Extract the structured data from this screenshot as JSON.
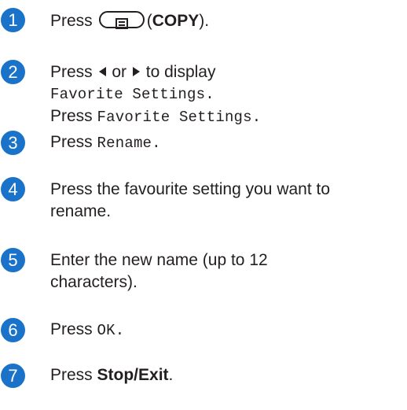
{
  "colors": {
    "badge": "#1a73c9",
    "text": "#231f20"
  },
  "steps": [
    {
      "num": "1",
      "pre": "Press",
      "post_open": "(",
      "bold": "COPY",
      "post_close": ")."
    },
    {
      "num": "2",
      "line1": "Press",
      "line1b": "or",
      "line1c": "to display",
      "mono1": "Favorite Settings.",
      "line3": "Press",
      "mono3": "Favorite Settings."
    },
    {
      "num": "3",
      "pre": "Press",
      "mono": "Rename."
    },
    {
      "num": "4",
      "line1": "Press the favourite setting you want to",
      "line2": "rename."
    },
    {
      "num": "5",
      "line1": "Enter the new name (up to 12",
      "line2": "characters)."
    },
    {
      "num": "6",
      "pre": "Press",
      "mono": "OK."
    },
    {
      "num": "7",
      "pre": "Press",
      "bold": "Stop/Exit",
      "post": "."
    }
  ]
}
